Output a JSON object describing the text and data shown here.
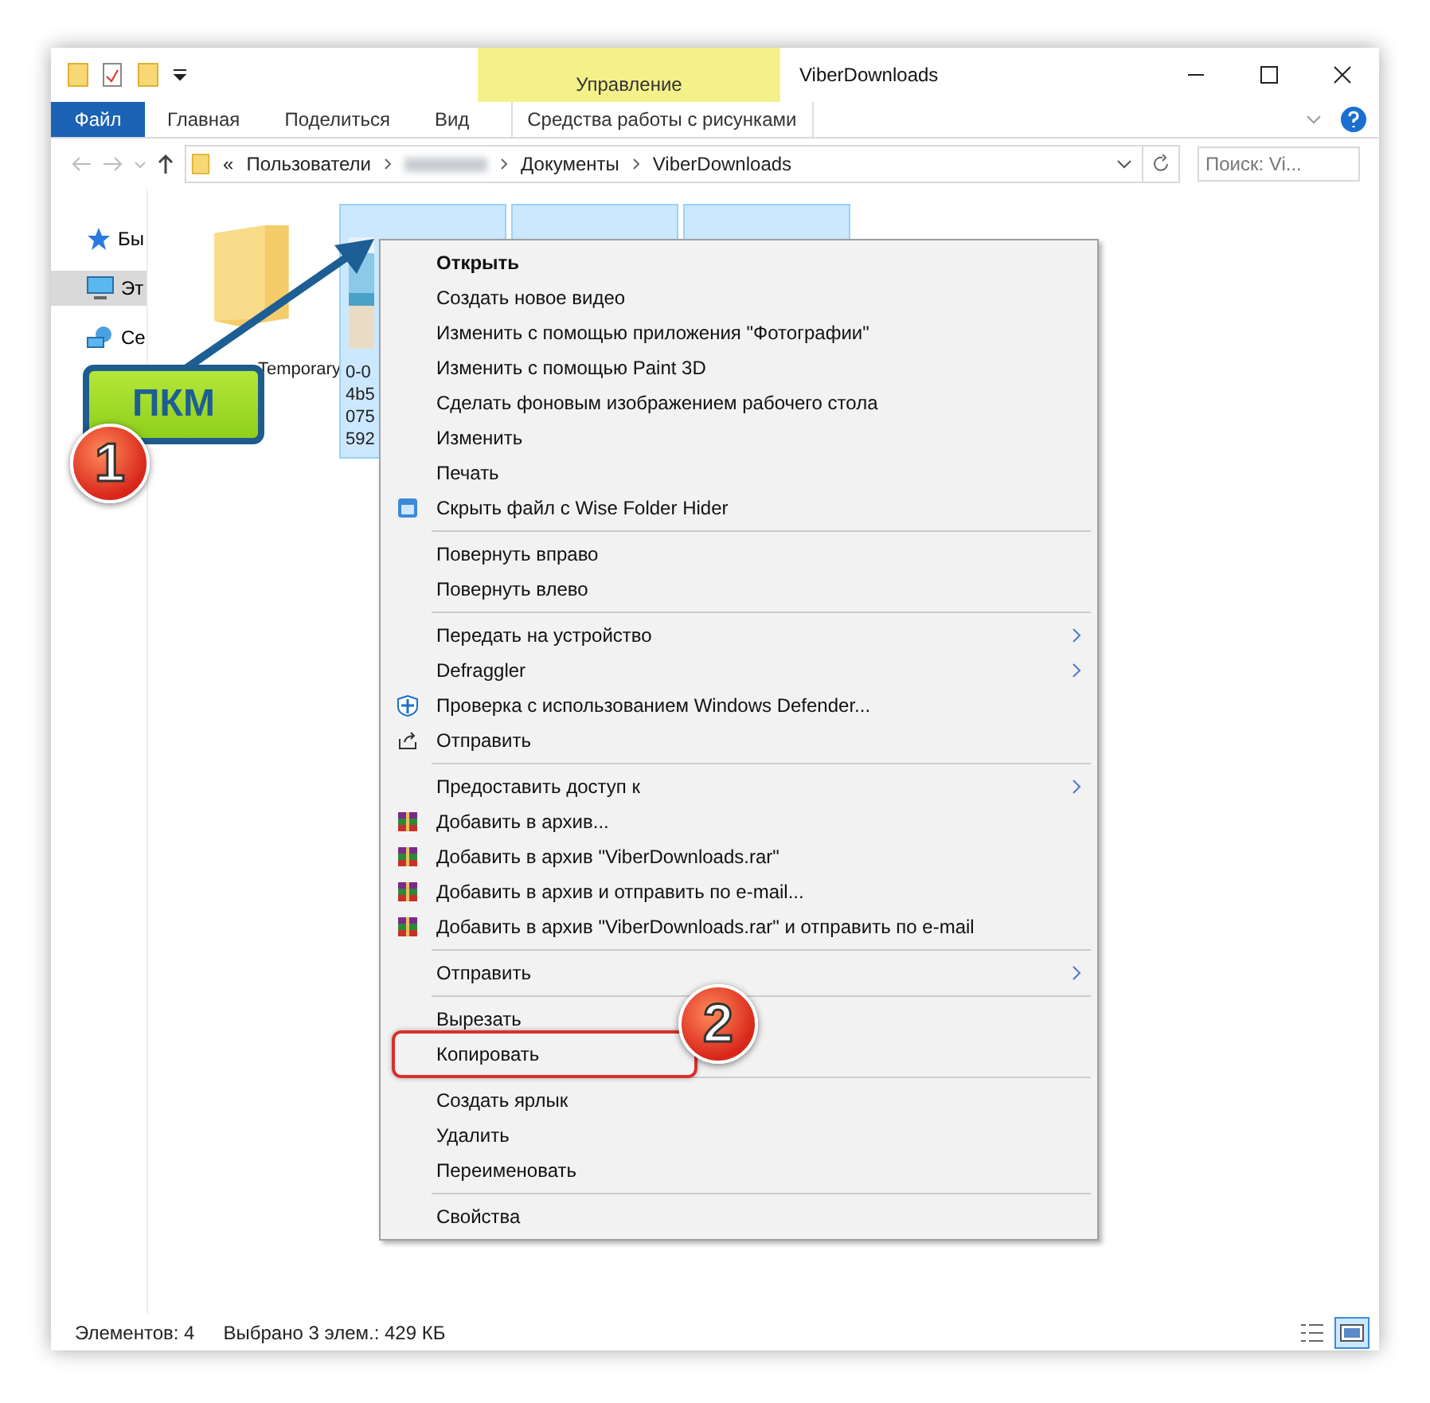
{
  "window": {
    "title": "ViberDownloads",
    "context_tab": "Управление"
  },
  "ribbon_tabs": [
    {
      "label": "Файл",
      "kind": "file"
    },
    {
      "label": "Главная",
      "kind": "tab"
    },
    {
      "label": "Поделиться",
      "kind": "tab"
    },
    {
      "label": "Вид",
      "kind": "tab"
    },
    {
      "label": "Средства работы с рисунками",
      "kind": "context"
    }
  ],
  "address": {
    "prefix": "«",
    "crumbs": [
      {
        "label": "Пользователи",
        "kind": "text"
      },
      {
        "kind": "redacted"
      },
      {
        "label": "Документы",
        "kind": "text"
      },
      {
        "label": "ViberDownloads",
        "kind": "text"
      }
    ]
  },
  "search": {
    "placeholder": "Поиск: Vi..."
  },
  "sidebar": {
    "items": [
      {
        "label": "Бы",
        "selected": false
      },
      {
        "label": "Эт",
        "selected": true
      },
      {
        "label": "Се",
        "selected": false
      }
    ]
  },
  "files": [
    {
      "kind": "folder",
      "name_lines": [
        "Temporary"
      ],
      "selected": false
    },
    {
      "name_lines": [
        "0-0",
        "4b5",
        "075",
        "592"
      ],
      "selected": true
    },
    {
      "kind": "hidden",
      "selected": true
    },
    {
      "kind": "hidden",
      "selected": true
    }
  ],
  "context_menu": [
    {
      "kind": "item",
      "label": "Открыть",
      "bold": true
    },
    {
      "kind": "item",
      "label": "Создать новое видео"
    },
    {
      "kind": "item",
      "label": "Изменить с помощью приложения \"Фотографии\""
    },
    {
      "kind": "item",
      "label": "Изменить с помощью Paint 3D"
    },
    {
      "kind": "item",
      "label": "Сделать фоновым изображением рабочего стола"
    },
    {
      "kind": "item",
      "label": "Изменить"
    },
    {
      "kind": "item",
      "label": "Печать"
    },
    {
      "kind": "hider",
      "label": "Скрыть файл с Wise Folder Hider"
    },
    {
      "kind": "separator"
    },
    {
      "kind": "item",
      "label": "Повернуть вправо"
    },
    {
      "kind": "item",
      "label": "Повернуть влево"
    },
    {
      "kind": "separator"
    },
    {
      "kind": "item",
      "label": "Передать на устройство",
      "submenu": true
    },
    {
      "kind": "item",
      "label": "Defraggler",
      "submenu": true
    },
    {
      "kind": "defender",
      "label": "Проверка с использованием Windows Defender..."
    },
    {
      "kind": "share",
      "label": "Отправить"
    },
    {
      "kind": "separator"
    },
    {
      "kind": "item",
      "label": "Предоставить доступ к",
      "submenu": true
    },
    {
      "kind": "archive",
      "label": "Добавить в архив..."
    },
    {
      "kind": "archive",
      "label": "Добавить в архив \"ViberDownloads.rar\""
    },
    {
      "kind": "archive",
      "label": "Добавить в архив и отправить по e-mail..."
    },
    {
      "kind": "archive",
      "label": "Добавить в архив \"ViberDownloads.rar\" и отправить по e-mail"
    },
    {
      "kind": "separator"
    },
    {
      "kind": "item",
      "label": "Отправить",
      "submenu": true
    },
    {
      "kind": "separator"
    },
    {
      "kind": "item",
      "label": "Вырезать"
    },
    {
      "kind": "item",
      "label": "Копировать",
      "highlighted": true
    },
    {
      "kind": "separator"
    },
    {
      "kind": "item",
      "label": "Создать ярлык"
    },
    {
      "kind": "item",
      "label": "Удалить"
    },
    {
      "kind": "item",
      "label": "Переименовать"
    },
    {
      "kind": "separator"
    },
    {
      "kind": "item",
      "label": "Свойства"
    }
  ],
  "annotations": {
    "label": "ПКМ",
    "step_1": "1",
    "step_2": "2"
  },
  "status_bar": {
    "count": "Элементов: 4",
    "selection": "Выбрано 3 элем.: 429 КБ",
    "view_buttons": [
      {
        "selected": false
      },
      {
        "selected": true
      }
    ]
  }
}
